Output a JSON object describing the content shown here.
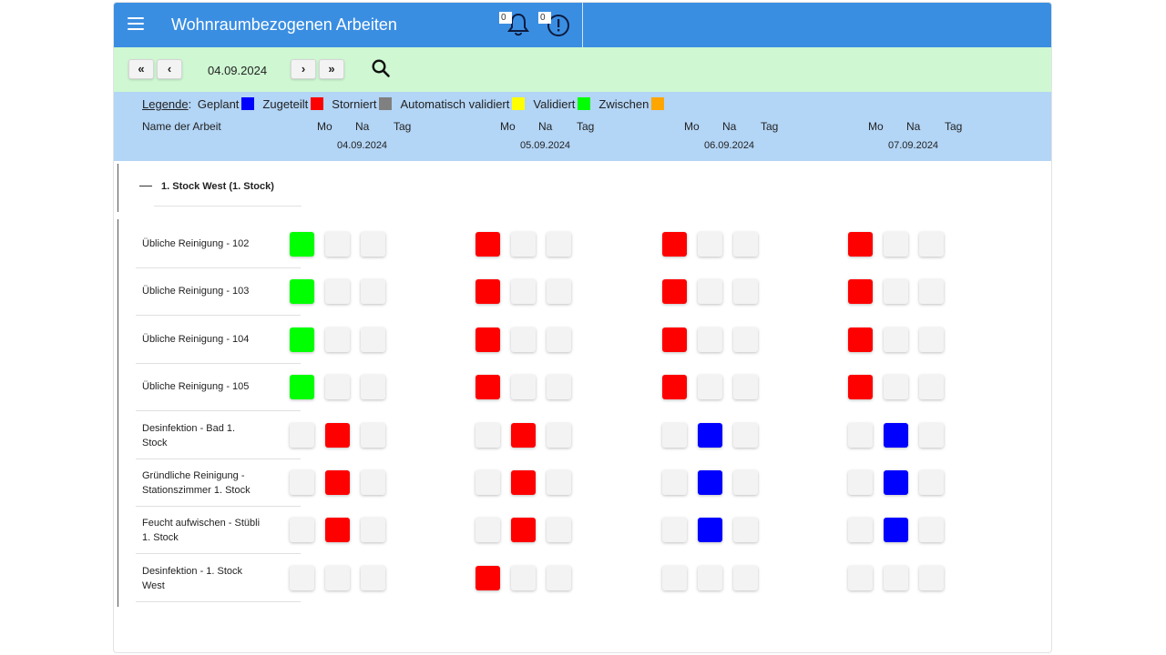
{
  "header": {
    "title": "Wohnraumbezogenen Arbeiten",
    "notifications_count": "0",
    "alerts_count": "0"
  },
  "toolbar": {
    "first_label": "«",
    "prev_label": "‹",
    "date": "04.09.2024",
    "next_label": "›",
    "last_label": "»"
  },
  "legend": {
    "title": "Legende",
    "colon": ":",
    "items": [
      {
        "label": "Geplant",
        "color": "#0000ff"
      },
      {
        "label": "Zugeteilt",
        "color": "#ff0000"
      },
      {
        "label": "Storniert",
        "color": "#808080"
      },
      {
        "label": "Automatisch validiert",
        "color": "#ffff00"
      },
      {
        "label": "Validiert",
        "color": "#00ff00"
      },
      {
        "label": "Zwischen",
        "color": "#ffa500"
      }
    ]
  },
  "columns": {
    "name_header": "Name der Arbeit",
    "shifts": [
      "Mo",
      "Na",
      "Tag"
    ],
    "dates": [
      "04.09.2024",
      "05.09.2024",
      "06.09.2024",
      "07.09.2024"
    ]
  },
  "group": {
    "label": "1. Stock West (1. Stock)"
  },
  "status_colors": {
    "empty": "#f3f3f3",
    "validiert": "#00ff00",
    "zugeteilt": "#ff0000",
    "geplant": "#0000ff"
  },
  "tasks": [
    {
      "name": "Übliche Reinigung - 102",
      "cells": [
        [
          "validiert",
          "empty",
          "empty"
        ],
        [
          "zugeteilt",
          "empty",
          "empty"
        ],
        [
          "zugeteilt",
          "empty",
          "empty"
        ],
        [
          "zugeteilt",
          "empty",
          "empty"
        ]
      ]
    },
    {
      "name": "Übliche Reinigung - 103",
      "cells": [
        [
          "validiert",
          "empty",
          "empty"
        ],
        [
          "zugeteilt",
          "empty",
          "empty"
        ],
        [
          "zugeteilt",
          "empty",
          "empty"
        ],
        [
          "zugeteilt",
          "empty",
          "empty"
        ]
      ]
    },
    {
      "name": "Übliche Reinigung - 104",
      "cells": [
        [
          "validiert",
          "empty",
          "empty"
        ],
        [
          "zugeteilt",
          "empty",
          "empty"
        ],
        [
          "zugeteilt",
          "empty",
          "empty"
        ],
        [
          "zugeteilt",
          "empty",
          "empty"
        ]
      ]
    },
    {
      "name": "Übliche Reinigung - 105",
      "cells": [
        [
          "validiert",
          "empty",
          "empty"
        ],
        [
          "zugeteilt",
          "empty",
          "empty"
        ],
        [
          "zugeteilt",
          "empty",
          "empty"
        ],
        [
          "zugeteilt",
          "empty",
          "empty"
        ]
      ]
    },
    {
      "name": "Desinfektion - Bad 1. Stock",
      "cells": [
        [
          "empty",
          "zugeteilt",
          "empty"
        ],
        [
          "empty",
          "zugeteilt",
          "empty"
        ],
        [
          "empty",
          "geplant",
          "empty"
        ],
        [
          "empty",
          "geplant",
          "empty"
        ]
      ]
    },
    {
      "name": "Gründliche Reinigung - Stationszimmer 1. Stock",
      "cells": [
        [
          "empty",
          "zugeteilt",
          "empty"
        ],
        [
          "empty",
          "zugeteilt",
          "empty"
        ],
        [
          "empty",
          "geplant",
          "empty"
        ],
        [
          "empty",
          "geplant",
          "empty"
        ]
      ]
    },
    {
      "name": "Feucht aufwischen - Stübli 1. Stock",
      "cells": [
        [
          "empty",
          "zugeteilt",
          "empty"
        ],
        [
          "empty",
          "zugeteilt",
          "empty"
        ],
        [
          "empty",
          "geplant",
          "empty"
        ],
        [
          "empty",
          "geplant",
          "empty"
        ]
      ]
    },
    {
      "name": "Desinfektion - 1. Stock West",
      "cells": [
        [
          "empty",
          "empty",
          "empty"
        ],
        [
          "zugeteilt",
          "empty",
          "empty"
        ],
        [
          "empty",
          "empty",
          "empty"
        ],
        [
          "empty",
          "empty",
          "empty"
        ]
      ]
    }
  ]
}
